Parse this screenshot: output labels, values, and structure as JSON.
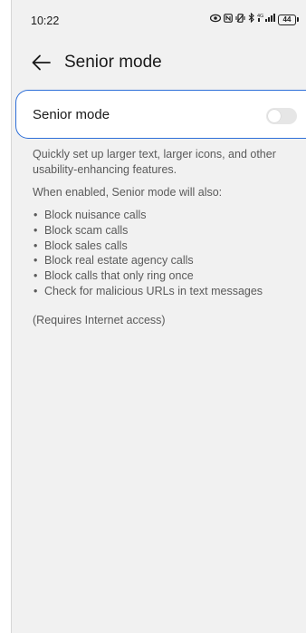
{
  "status_bar": {
    "time": "10:22",
    "icons": [
      "eye-icon",
      "nfc-icon",
      "vibrate-icon",
      "bluetooth-icon",
      "4g-signal-icon"
    ],
    "network_label": "4G",
    "battery_level": "44"
  },
  "header": {
    "back_icon": "arrow-left-icon",
    "title": "Senior mode"
  },
  "setting": {
    "label": "Senior mode",
    "enabled": false
  },
  "description": {
    "intro": "Quickly set up larger text, larger icons, and other usability-enhancing features.",
    "when_enabled": "When enabled, Senior mode will also:",
    "features": [
      "Block nuisance calls",
      "Block scam calls",
      "Block sales calls",
      "Block real estate agency calls",
      "Block calls that only ring once",
      "Check for malicious URLs in text messages"
    ],
    "note": "(Requires Internet access)"
  },
  "colors": {
    "accent": "#2e6fd8",
    "background": "#f1f1f1",
    "card": "#ffffff",
    "secondary_text": "#5a5a5a"
  }
}
